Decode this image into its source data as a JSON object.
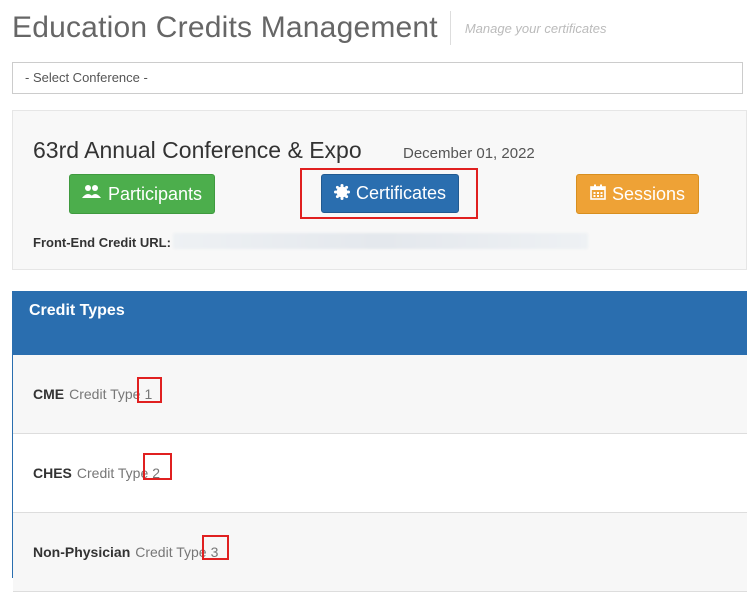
{
  "header": {
    "title": "Education Credits Management",
    "subtitle": "Manage your certificates"
  },
  "conference_select": {
    "value": "- Select Conference -"
  },
  "conference": {
    "name": "63rd Annual Conference & Expo",
    "date": "December 01, 2022",
    "buttons": {
      "participants": "Participants",
      "certificates": "Certificates",
      "sessions": "Sessions"
    },
    "credit_url_label": "Front-End Credit URL:"
  },
  "credit_types": {
    "heading": "Credit Types",
    "rows": [
      {
        "name": "CME",
        "label": "Credit Type",
        "number": "1"
      },
      {
        "name": "CHES",
        "label": "Credit Type",
        "number": "2"
      },
      {
        "name": "Non-Physician",
        "label": "Credit Type",
        "number": "3"
      }
    ]
  },
  "colors": {
    "primary": "#2a6eaf",
    "success": "#4cae4c",
    "warning": "#eea236",
    "highlight": "#e02020"
  },
  "icons": {
    "participants": "users-icon",
    "certificates": "certificate-icon",
    "sessions": "calendar-icon"
  }
}
